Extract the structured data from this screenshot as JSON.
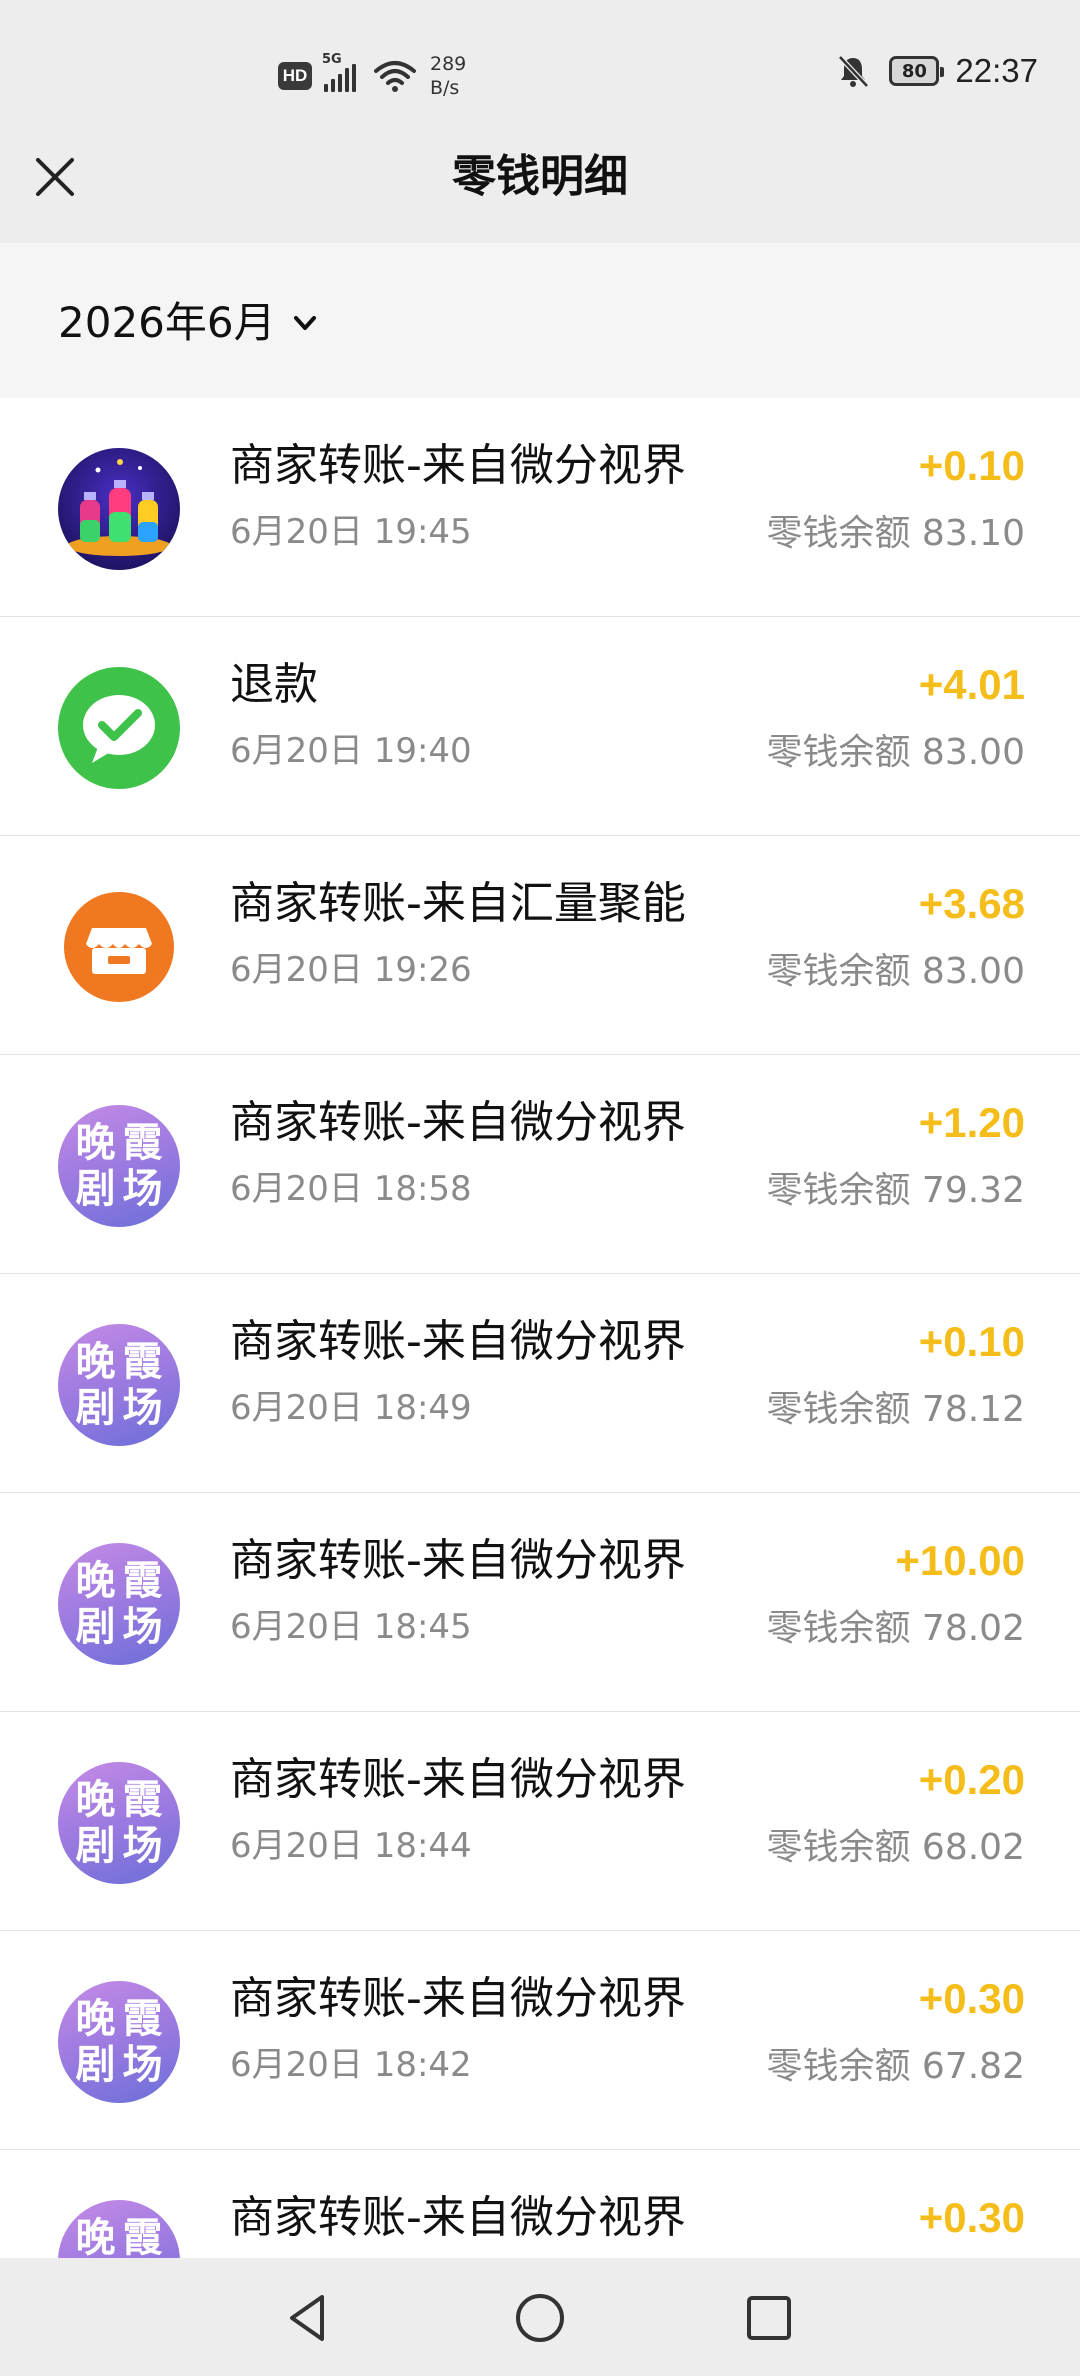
{
  "status_bar": {
    "hd": "HD",
    "network": "5G",
    "speed_value": "289",
    "speed_unit": "B/s",
    "battery": "80",
    "time": "22:37"
  },
  "header": {
    "title": "零钱明细"
  },
  "filter": {
    "month": "2026年6月"
  },
  "transactions": [
    {
      "title": "商家转账-来自微分视界",
      "time": "6月20日 19:45",
      "amount": "+0.10",
      "balance": "零钱余额 83.10",
      "avatar": "game-bottles"
    },
    {
      "title": "退款",
      "time": "6月20日 19:40",
      "amount": "+4.01",
      "balance": "零钱余额 83.00",
      "avatar": "wechat-logo"
    },
    {
      "title": "商家转账-来自汇量聚能",
      "time": "6月20日 19:26",
      "amount": "+3.68",
      "balance": "零钱余额 83.00",
      "avatar": "shop-icon"
    },
    {
      "title": "商家转账-来自微分视界",
      "time": "6月20日 18:58",
      "amount": "+1.20",
      "balance": "零钱余额 79.32",
      "avatar": "theater-logo"
    },
    {
      "title": "商家转账-来自微分视界",
      "time": "6月20日 18:49",
      "amount": "+0.10",
      "balance": "零钱余额 78.12",
      "avatar": "theater-logo"
    },
    {
      "title": "商家转账-来自微分视界",
      "time": "6月20日 18:45",
      "amount": "+10.00",
      "balance": "零钱余额 78.02",
      "avatar": "theater-logo"
    },
    {
      "title": "商家转账-来自微分视界",
      "time": "6月20日 18:44",
      "amount": "+0.20",
      "balance": "零钱余额 68.02",
      "avatar": "theater-logo"
    },
    {
      "title": "商家转账-来自微分视界",
      "time": "6月20日 18:42",
      "amount": "+0.30",
      "balance": "零钱余额 67.82",
      "avatar": "theater-logo"
    },
    {
      "title": "商家转账-来自微分视界",
      "time": "",
      "amount": "+0.30",
      "balance": "",
      "avatar": "theater-logo"
    }
  ],
  "theater_logo_chars": [
    "晚",
    "霞",
    "剧",
    "场"
  ],
  "colors": {
    "amount": "#f5bd1a",
    "secondary_text": "#8a8a8a",
    "header_bg": "#ededed"
  }
}
